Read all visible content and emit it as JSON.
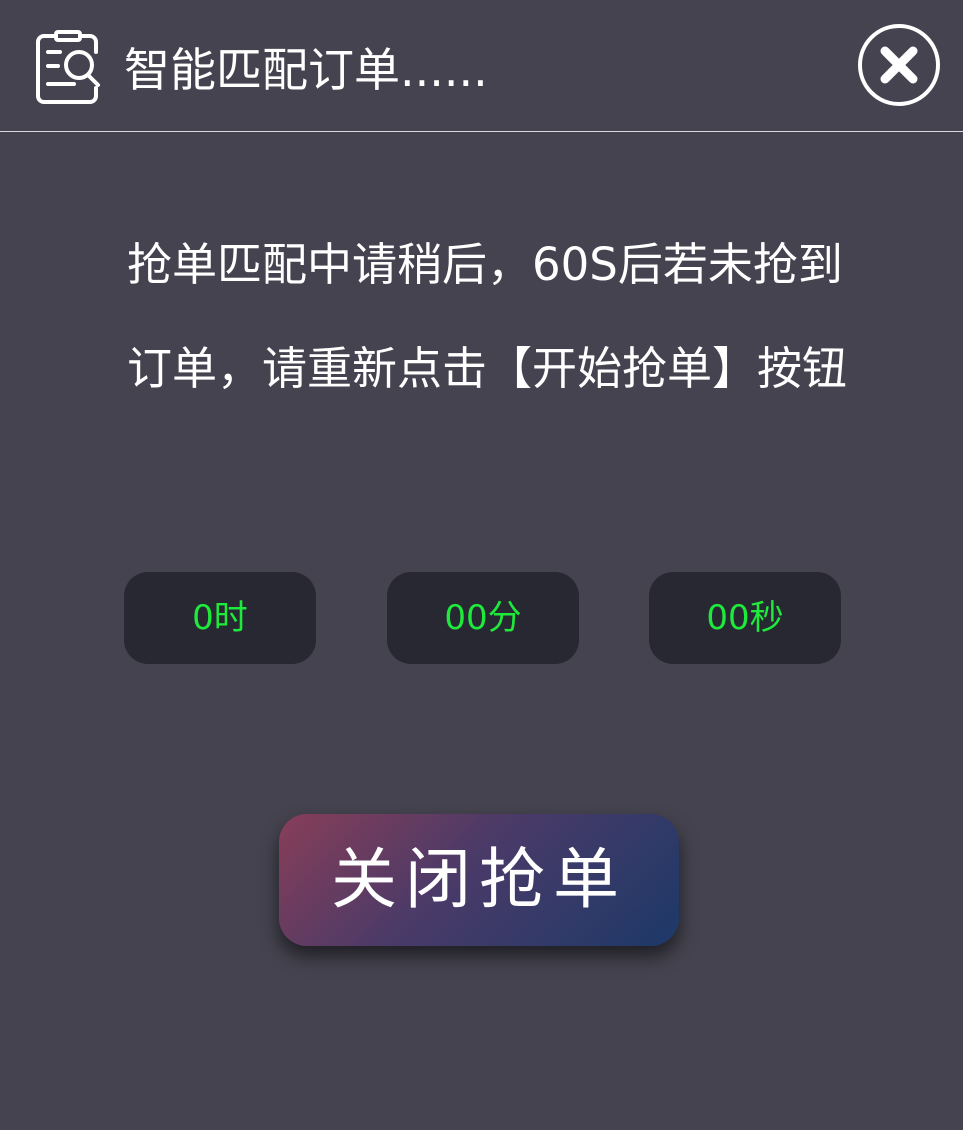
{
  "header": {
    "title": "智能匹配订单......",
    "icon": "order-search-icon",
    "close_icon": "close-icon"
  },
  "message": {
    "text": "抢单匹配中请稍后，60S后若未抢到订单，请重新点击【开始抢单】按钮"
  },
  "timer": {
    "hours": "0时",
    "minutes": "00分",
    "seconds": "00秒",
    "color": "#1dea3a"
  },
  "actions": {
    "close_grab_label": "关闭抢单"
  },
  "colors": {
    "background": "#44434f",
    "timer_box": "#282833",
    "button_gradient_start": "#883e58",
    "button_gradient_end": "#1c3968"
  }
}
